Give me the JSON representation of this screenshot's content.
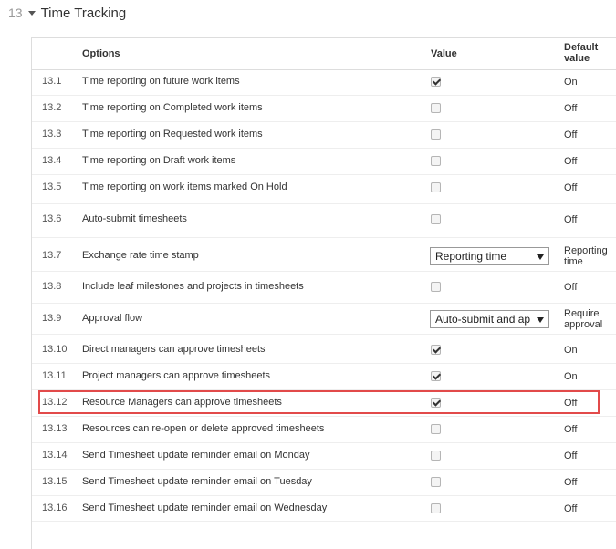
{
  "section": {
    "number": "13",
    "title": "Time Tracking"
  },
  "table": {
    "headers": {
      "options": "Options",
      "value": "Value",
      "default_line1": "Default",
      "default_line2": "value"
    },
    "rows": [
      {
        "num": "13.1",
        "label": "Time reporting on future work items",
        "type": "checkbox",
        "checked": true,
        "default": "On"
      },
      {
        "num": "13.2",
        "label": "Time reporting on Completed work items",
        "type": "checkbox",
        "checked": false,
        "default": "Off"
      },
      {
        "num": "13.3",
        "label": "Time reporting on Requested work items",
        "type": "checkbox",
        "checked": false,
        "default": "Off"
      },
      {
        "num": "13.4",
        "label": "Time reporting on Draft work items",
        "type": "checkbox",
        "checked": false,
        "default": "Off"
      },
      {
        "num": "13.5",
        "label": "Time reporting on work items marked On Hold",
        "type": "checkbox",
        "checked": false,
        "default": "Off"
      },
      {
        "num": "13.6",
        "label": "Auto-submit timesheets",
        "type": "checkbox",
        "checked": false,
        "default": "Off"
      },
      {
        "num": "13.7",
        "label": "Exchange rate time stamp",
        "type": "select",
        "value": "Reporting time",
        "default_line1": "Reporting",
        "default_line2": "time"
      },
      {
        "num": "13.8",
        "label": "Include leaf milestones and projects in timesheets",
        "type": "checkbox",
        "checked": false,
        "default": "Off"
      },
      {
        "num": "13.9",
        "label": "Approval flow",
        "type": "select",
        "value": "Auto-submit and ap",
        "default_line1": "Require",
        "default_line2": "approval"
      },
      {
        "num": "13.10",
        "label": "Direct managers can approve timesheets",
        "type": "checkbox",
        "checked": true,
        "default": "On"
      },
      {
        "num": "13.11",
        "label": "Project managers can approve timesheets",
        "type": "checkbox",
        "checked": true,
        "default": "On"
      },
      {
        "num": "13.12",
        "label": "Resource Managers can approve timesheets",
        "type": "checkbox",
        "checked": true,
        "default": "Off"
      },
      {
        "num": "13.13",
        "label": "Resources can re-open or delete approved timesheets",
        "type": "checkbox",
        "checked": false,
        "default": "Off"
      },
      {
        "num": "13.14",
        "label": "Send Timesheet update reminder email on Monday",
        "type": "checkbox",
        "checked": false,
        "default": "Off"
      },
      {
        "num": "13.15",
        "label": "Send Timesheet update reminder email on Tuesday",
        "type": "checkbox",
        "checked": false,
        "default": "Off"
      },
      {
        "num": "13.16",
        "label": "Send Timesheet update reminder email on Wednesday",
        "type": "checkbox",
        "checked": false,
        "default": "Off"
      }
    ]
  },
  "colors": {
    "highlight": "#e24a4a"
  }
}
